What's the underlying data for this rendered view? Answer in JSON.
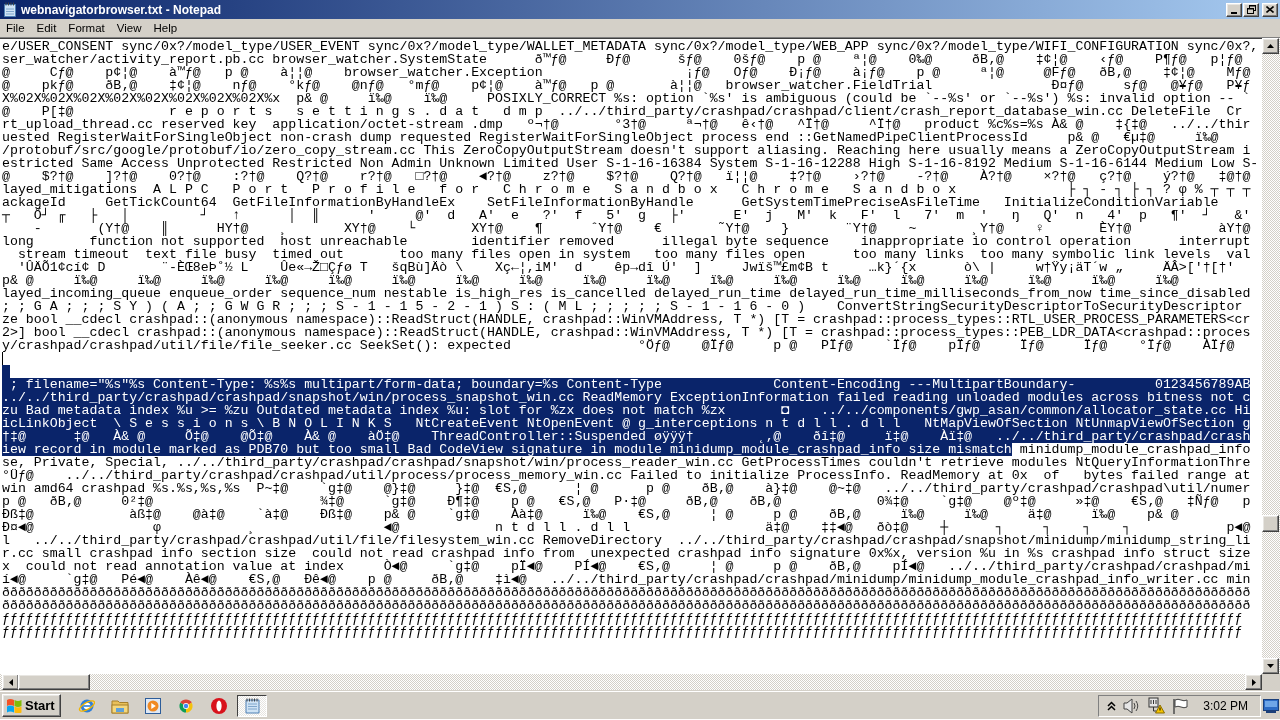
{
  "window": {
    "title": "webnavigatorbrowser.txt - Notepad"
  },
  "menu": [
    "File",
    "Edit",
    "Format",
    "View",
    "Help"
  ],
  "editor": {
    "lines": [
      {
        "kind": "text",
        "selected": false,
        "text": "e/USER_CONSENT sync/0x?/model_type/USER_EVENT sync/0x?/model_type/WALLET_METADATA sync/0x?/model_type/WEB_APP sync/0x?/model_type/WIFI_CONFIGURATION sync/0x?,"
      },
      {
        "kind": "text",
        "selected": false,
        "text": "ser_watcher/activity_report.pb.cc browser_watcher.SystemState      ð™ƒ@     Ðƒ@      šƒ@    0šƒ@    p @    ª¦@    0‰@     ðB‚@    ‡¢¦@    ‹ƒ@    P¶ƒ@   p¦ƒ@"
      },
      {
        "kind": "text",
        "selected": false,
        "text": "@     Cƒ@    p¢¦@    à™ƒ@   p @    à¦¦@    browser_watcher.Exception                  ¡ƒ@   Oƒ@    Ð¡ƒ@    à¡ƒ@    p @     ª¦@     @Fƒ@   ðB‚@    ‡¢¦@    Mƒ@"
      },
      {
        "kind": "text",
        "selected": false,
        "text": "@    pkƒ@    ðB‚@    ‡¢¦@    nƒ@    °kƒ@    @nƒ@   °mƒ@    p¢¦@    à™ƒ@   p @       à¦¦@   browser_watcher.FieldTrial               Ð¤ƒ@     sƒ@   @¥ƒ@   P¥ƒ"
      },
      {
        "kind": "text",
        "selected": false,
        "text": "X%02X%02X%02X%02X%02X%02X%02X%02X%x  p& @     ï‰@    ï‰@     POSIXLY_CORRECT %s: option `%s' is ambiguous (could be `--%s' or `--%s') %s: invalid option -- `"
      },
      {
        "kind": "text",
        "selected": false,
        "text": "@    P[‡@            r e p o r t s   s e t t i n g s . d a t   d m p  ../../third_party/crashpad/crashpad/client/crash_report_database_win.cc DeleteFile  Cr"
      },
      {
        "kind": "text",
        "selected": false,
        "text": "rt_upload_thread.cc reserved key  application/octet-stream .dmp   º¬†@       °3†@     ª¬†@   ê‹†@   ^Ï†@     ^Ï†@   product %c%s=%s À& @    ‡{‡@   ../../thir"
      },
      {
        "kind": "text",
        "selected": false,
        "text": "uested RegisterWaitForSingleObject non-crash dump requested RegisterWaitForSingleObject process end ::GetNamedPipeClientProcessId     p& @   €µ‡@     ï‰@"
      },
      {
        "kind": "text",
        "selected": false,
        "text": "/protobuf/src/google/protobuf/io/zero_copy_stream.cc This ZeroCopyOutputStream doesn't support aliasing. Reaching here usually means a ZeroCopyOutputStream i"
      },
      {
        "kind": "text",
        "selected": false,
        "text": "estricted Same Access Unprotected Restricted Non Admin Unknown Limited User S-1-16-16384 System S-1-16-12288 High S-1-16-8192 Medium S-1-16-6144 Medium Low S-"
      },
      {
        "kind": "text",
        "selected": false,
        "text": "@    $?†@    ]?†@    0?†@    :?†@    Q?†@    r?†@   □?†@    ◄?†@    z?†@    $?†@    Q?†@   ï¦¦@    ‡?†@    ›?†@    -?†@    À?†@    ×?†@   ç?†@    ý?†@   ‡@†@"
      },
      {
        "kind": "text",
        "selected": false,
        "text": "layed_mitigations  A L P C   P o r t   P r o f i l e   f o r   C h r o m e   S a n d b o x   C h r o m e   S a n d b o x              ├ ┐ - ┐ ├ ┐ ? φ % ┬ ┬ ┬"
      },
      {
        "kind": "text",
        "selected": false,
        "text": "ackageId     GetTickCount64  GetFileInformationByHandleEx    SetFileInformationByHandle      GetSystemTimePreciseAsFileTime   InitializeConditionVariable"
      },
      {
        "kind": "text",
        "selected": false,
        "text": "┬   Ő┘ ╓   ├   │         ┘   ↑      │  ║      '     @'  d   A'  e   ?'  f   5'  g   ├'      E'  j   M'  k   F'  l   7'  m  '   ŋ   Q'  n   4'  p   ¶'  ┘   &'"
      },
      {
        "kind": "text",
        "selected": false,
        "text": "    -       (Y†@    ║      HY†@    ¸       XY†@    └       XY†@    ¶      ˆY†@    €       ˜Y†@    }       ¨Y†@    ~       ¸Y†@    ♀       ÈY†@           àY†@"
      },
      {
        "kind": "text",
        "selected": false,
        "text": "long       function not supported  host unreachable        identifier removed      illegal byte sequence    inappropriate io control operation      interrupt"
      },
      {
        "kind": "text",
        "selected": false,
        "text": "  stream timeout  text file busy  timed out       too many files open in system   too many files open      too many links  too many symbolic link levels  val"
      },
      {
        "kind": "text",
        "selected": false,
        "text": "  'ÛÄÕ1¢cí¢ D       ¨-ÈŒ8eÞ˚½ L    Ûe«→Ž□Çƒø T   šqBù]Äò \\    Xç←¦,iM'  d    êp→dî Ú'  ]     Jwïš™£m¢B t     …k}´{x      ò\\ |     w†Ÿy¡äT´w „     ÄÂ>['†[†'"
      },
      {
        "kind": "text",
        "selected": false,
        "text": "p& @     ï‰@     ï‰@     ï‰@     ï‰@     ï‰@     ï‰@     ï‰@     ï‰@     ï‰@     ï‰@     ï‰@     ï‰@     ï‰@     ï‰@     ï‰@     ï‰@     ï‰@     ï‰@"
      },
      {
        "kind": "text",
        "selected": false,
        "text": "layed_incoming_queue enqueue_order sequence_num nestable is_high_res is_cancelled delayed_run_time delayed_run_time_milliseconds_from_now time_since_disabled"
      },
      {
        "kind": "text",
        "selected": false,
        "text": "; ; G A ; ; ; S Y ) ( A ; ; G W G R ; ; ; S - 1 - 1 5 - 2 - 1 ) S : ( M L ; ; ; ; ; S - 1 - 1 6 - 0 )    ConvertStringSecurityDescriptorToSecurityDescriptor"
      },
      {
        "kind": "text",
        "selected": false,
        "text": "ze bool __cdecl crashpad::(anonymous namespace)::ReadStruct(HANDLE, crashpad::WinVMAddress, T *) [T = crashpad::process_types::RTL_USER_PROCESS_PARAMETERS<cr"
      },
      {
        "kind": "text",
        "selected": false,
        "text": "2>] bool __cdecl crashpad::(anonymous namespace)::ReadStruct(HANDLE, crashpad::WinVMAddress, T *) [T = crashpad::process_types::PEB_LDR_DATA<crashpad::proces"
      },
      {
        "kind": "text",
        "selected": false,
        "text": "y/crashpad/crashpad/util/file/file_seeker.cc SeekSet(): expected                °Öƒ@    @Ïƒ@     p @   PÏƒ@    `Ïƒ@    pÏƒ@     Ïƒ@     Ïƒ@    °Ïƒ@    ÀÏƒ@"
      },
      {
        "kind": "blank",
        "selected": false,
        "caret": true
      },
      {
        "kind": "blank",
        "selected": true,
        "caret": false
      },
      {
        "kind": "text",
        "selected": true,
        "text": " ; filename=\"%s\"%s Content-Type: %s%s multipart/form-data; boundary=%s Content-Type              Content-Encoding ---MultipartBoundary-          0123456789AB"
      },
      {
        "kind": "text",
        "selected": true,
        "text": "../../third_party/crashpad/crashpad/snapshot/win/process_snapshot_win.cc ReadMemory ExceptionInformation failed reading unloaded modules across bitness not c"
      },
      {
        "kind": "text",
        "selected": true,
        "text": "zu Bad metadata index %u >= %zu Outdated metadata index %u: slot for %zx does not match %zx       ◘    ../../components/gwp_asan/common/allocator_state.cc Hi"
      },
      {
        "kind": "text",
        "selected": true,
        "text": "icLinkObject  \\ S e s s i o n s \\ B N O L I N K S   NtCreateEvent NtOpenEvent @ g_interceptions n t d l l . d l l   NtMapViewOfSection NtUnmapViewOfSection g"
      },
      {
        "kind": "text",
        "selected": true,
        "text": "†‡@      ‡@   À& @     Õ‡@    @Õ‡@    À& @    àÖ‡@    ThreadController::Suspended øÿÿÿ†        ˛‚@    ðî‡@     ï‡@    Àï‡@   ../../third_party/crashpad/crash"
      },
      {
        "kind": "split",
        "parts": [
          {
            "text": "iew record in module marked as PDB70 but too small Bad CodeView signature in module minidump_module_crashpad_info size mismatch",
            "selected": true
          },
          {
            "text": " minidump_module_crashpad_info",
            "selected": false
          }
        ]
      },
      {
        "kind": "text",
        "selected": false,
        "text": "se, Private, Special, ../../third_party/crashpad/crashpad/snapshot/win/process_reader_win.cc GetProcessTimes couldn't retrieve modules NtQueryInformationThre"
      },
      {
        "kind": "text",
        "selected": false,
        "text": "°Üƒ@    ../../third_party/crashpad/crashpad/util/process/process_memory_win.cc Failed to initialize ProcessInfo. ReadMemory at 0x  of   bytes failed range at"
      },
      {
        "kind": "text",
        "selected": false,
        "text": "win amd64 crashpad %s.%s,%s,%s  P~‡@    `g‡@    @}‡@     }‡@  €S‚@      ¦ @      p @    ðB‚@    à}‡@    @~‡@   ../../third_party/crashpad/crashpad\\util/numer"
      },
      {
        "kind": "text",
        "selected": false,
        "text": "p @   ðB‚@     0²‡@                     ¾‡@     `g‡@    Ð¶‡@    p @   €S‚@   P·‡@     ðB‚@    ðB‚@            0¾‡@    `g‡@    @º‡@     »‡@    €S‚@   ‡Ñƒ@   p"
      },
      {
        "kind": "text",
        "selected": false,
        "text": "Ðß‡@            àß‡@    @à‡@    `à‡@    Ðß‡@    p& @    `g‡@    Àà‡@     ï‰@    €S‚@     ¦ @     p @    ðB‚@     ï‰@     ï‰@     ä‡@     ï‰@    p& @"
      },
      {
        "kind": "text",
        "selected": false,
        "text": "Ð¤◄@               φ           ¸                ◄@            n t d l l . d l l                 ä‡@    ‡‡◄@   ðò‡@    ┼      ┐     ┐    ┐    ┐            p◄@"
      },
      {
        "kind": "text",
        "selected": false,
        "text": "l   ../../third_party/crashpad/crashpad/util/file/filesystem_win.cc RemoveDirectory  ../../third_party/crashpad/crashpad/snapshot/minidump/minidump_string_li"
      },
      {
        "kind": "text",
        "selected": false,
        "text": "r.cc small crashpad info section size  could not read crashpad info from  unexpected crashpad info signature 0x%x, version %u in %s crashpad info struct size"
      },
      {
        "kind": "text",
        "selected": false,
        "text": "x  could not read annotation value at index     Ò◄@     `g‡@    pÏ◄@    PÍ◄@    €S‚@     ¦ @     p @    ðB‚@    pÍ◄@   ../../third_party/crashpad/crashpad/mi"
      },
      {
        "kind": "text",
        "selected": false,
        "text": "í◄@     `g‡@   Pé◄@    Àê◄@    €S‚@   Ðê◄@    p @     ðB‚@    ‡ì◄@   ../../third_party/crashpad/crashpad/minidump/minidump_module_crashpad_info_writer.cc min"
      },
      {
        "kind": "text",
        "selected": false,
        "text": "ððððððððððððððððððððððððððððððððððððððððððððððððððððððððððððððððððððððððððððððððððððððððððððððððððððððððððððððððððððððððððððððððððððððððððððððððððððððððððððð"
      },
      {
        "kind": "text",
        "selected": false,
        "text": "ððððððððððððððððððððððððððððððððððððððððððððððððððððððððððððððððððððððððððððððððððððððððððððððððððððððððððððððððððððððððððððððððððððððððððððððððððððððððððððð"
      },
      {
        "kind": "text",
        "selected": false,
        "text": "ƒƒƒƒƒƒƒƒƒƒƒƒƒƒƒƒƒƒƒƒƒƒƒƒƒƒƒƒƒƒƒƒƒƒƒƒƒƒƒƒƒƒƒƒƒƒƒƒƒƒƒƒƒƒƒƒƒƒƒƒƒƒƒƒƒƒƒƒƒƒƒƒƒƒƒƒƒƒƒƒƒƒƒƒƒƒƒƒƒƒƒƒƒƒƒƒƒƒƒƒƒƒƒƒƒƒƒƒƒƒƒƒƒƒƒƒƒƒƒƒƒƒƒƒƒƒƒƒƒƒƒƒƒƒƒƒƒƒƒƒƒƒƒƒƒƒƒƒƒƒƒƒƒƒƒƒ"
      },
      {
        "kind": "text",
        "selected": false,
        "text": "ƒƒƒƒƒƒƒƒƒƒƒƒƒƒƒƒƒƒƒƒƒƒƒƒƒƒƒƒƒƒƒƒƒƒƒƒƒƒƒƒƒƒƒƒƒƒƒƒƒƒƒƒƒƒƒƒƒƒƒƒƒƒƒƒƒƒƒƒƒƒƒƒƒƒƒƒƒƒƒƒƒƒƒƒƒƒƒƒƒƒƒƒƒƒƒƒƒƒƒƒƒƒƒƒƒƒƒƒƒƒƒƒƒƒƒƒƒƒƒƒƒƒƒƒƒƒƒƒƒƒƒƒƒƒƒƒƒƒƒƒƒƒƒƒƒƒƒƒƒƒƒƒƒƒƒƒ"
      }
    ]
  },
  "taskbar": {
    "start": "Start",
    "apps": [
      {
        "kind": "ie",
        "active": false
      },
      {
        "kind": "folder",
        "active": false
      },
      {
        "kind": "media",
        "active": false
      },
      {
        "kind": "chrome",
        "active": false
      },
      {
        "kind": "ring",
        "active": false
      },
      {
        "kind": "notepad",
        "active": true
      }
    ],
    "clock": "3:02 PM"
  }
}
